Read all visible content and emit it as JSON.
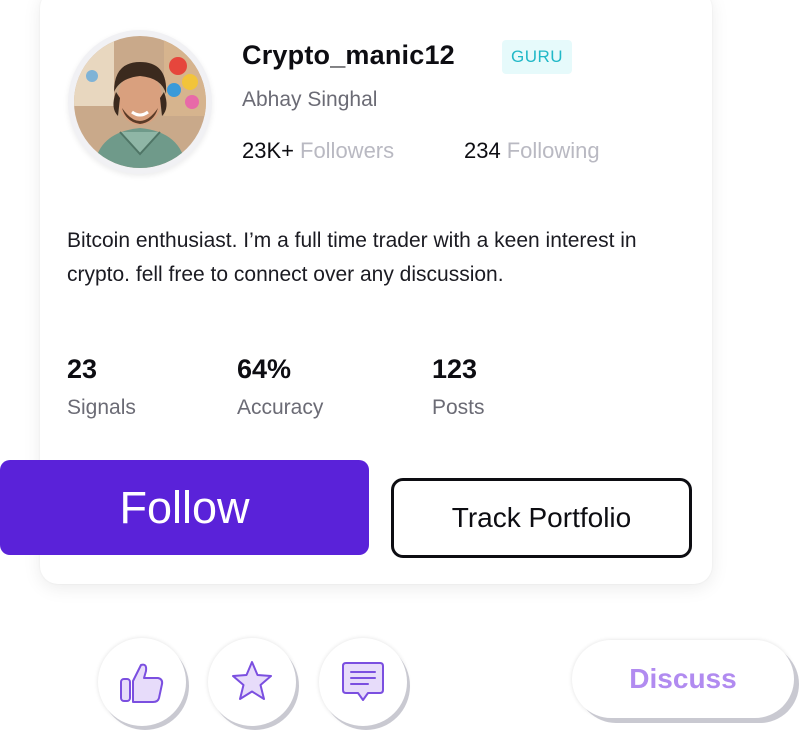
{
  "profile": {
    "username": "Crypto_manic12",
    "badge": "GURU",
    "full_name": "Abhay Singhal",
    "followers_count": "23K+",
    "followers_label": "Followers",
    "following_count": "234",
    "following_label": "Following",
    "bio": "Bitcoin enthusiast. I’m a full time trader with a keen interest in crypto. fell free to connect over any discussion."
  },
  "metrics": [
    {
      "value": "23",
      "label": "Signals"
    },
    {
      "value": "64%",
      "label": "Accuracy"
    },
    {
      "value": "123",
      "label": "Posts"
    }
  ],
  "actions": {
    "follow_label": "Follow",
    "track_label": "Track Portfolio",
    "discuss_label": "Discuss"
  },
  "icons": {
    "like": "thumbs-up-icon",
    "favorite": "star-icon",
    "comment": "chat-bubble-icon"
  },
  "colors": {
    "primary": "#5a22d9",
    "badge_text": "#21b8c7",
    "badge_bg": "#e6fafb",
    "icon_stroke": "#7b4fe0",
    "icon_fill": "#e7dcfa",
    "discuss_text": "#b18bf0"
  }
}
